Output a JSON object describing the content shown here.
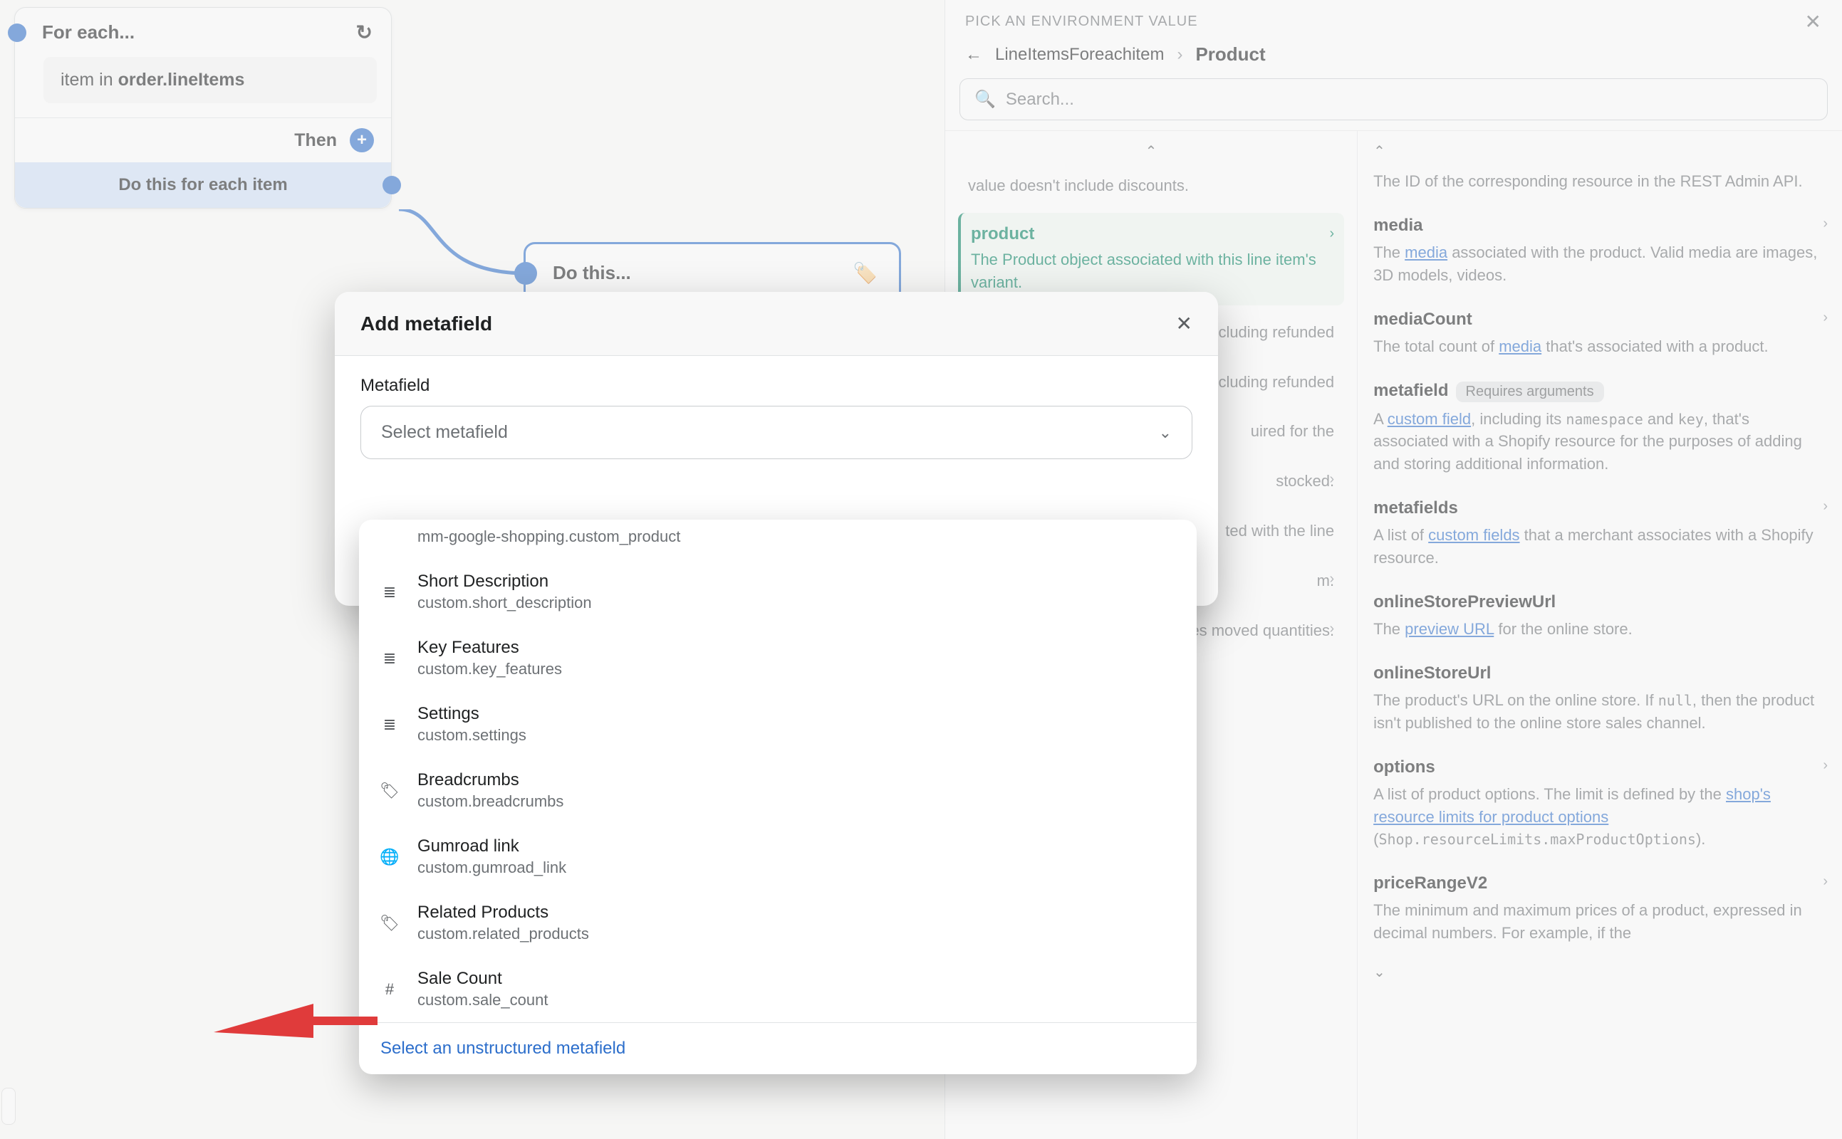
{
  "canvas": {
    "foreach_title": "For each...",
    "item_prefix": "item in ",
    "item_source": "order.lineItems",
    "then": "Then",
    "do_each": "Do this for each item",
    "do_this": "Do this..."
  },
  "panel": {
    "title": "PICK AN ENVIRONMENT VALUE",
    "back_label": "LineItemsForeachitem",
    "current": "Product",
    "search_placeholder": "Search..."
  },
  "left_fields": {
    "truncated_desc": "value doesn't include discounts.",
    "product_title": "product",
    "product_desc": "The Product object associated with this line item's variant.",
    "f1": "… including refunded",
    "f2": "excluding refunded",
    "f3": "uired for the",
    "f4": "stocked.",
    "f5": "ted with the line",
    "f6": "m.",
    "f7": "e item, including taxes moved quantities."
  },
  "props": {
    "p0_desc_prefix": "The ID of the corresponding resource in the REST Admin API.",
    "media_title": "media",
    "media_desc_a": "The ",
    "media_link": "media",
    "media_desc_b": " associated with the product. Valid media are images, 3D models, videos.",
    "mediaCount_title": "mediaCount",
    "mediaCount_a": "The total count of ",
    "mediaCount_link": "media",
    "mediaCount_b": " that's associated with a product.",
    "metafield_title": "metafield",
    "metafield_badge": "Requires arguments",
    "metafield_a": "A ",
    "metafield_link": "custom field",
    "metafield_b": ", including its ",
    "metafield_code1": "namespace",
    "metafield_c": " and ",
    "metafield_code2": "key",
    "metafield_d": ", that's associated with a Shopify resource for the purposes of adding and storing additional information.",
    "metafields_title": "metafields",
    "metafields_a": "A list of ",
    "metafields_link": "custom fields",
    "metafields_b": " that a merchant associates with a Shopify resource.",
    "preview_title": "onlineStorePreviewUrl",
    "preview_a": "The ",
    "preview_link": "preview URL",
    "preview_b": " for the online store.",
    "url_title": "onlineStoreUrl",
    "url_a": "The product's URL on the online store. If ",
    "url_code": "null",
    "url_b": ", then the product isn't published to the online store sales channel.",
    "options_title": "options",
    "options_a": "A list of product options. The limit is defined by the ",
    "options_link": "shop's resource limits for product options",
    "options_b": " (",
    "options_code": "Shop.resourceLimits.maxProductOptions",
    "options_c": ").",
    "price_title": "priceRangeV2",
    "price_desc": "The minimum and maximum prices of a product, expressed in decimal numbers. For example, if the"
  },
  "modal": {
    "title": "Add metafield",
    "label": "Metafield",
    "placeholder": "Select metafield",
    "footer_link": "Select an unstructured metafield"
  },
  "dropdown": {
    "top_key": "mm-google-shopping.custom_product",
    "items": [
      {
        "icon": "text",
        "title": "Short Description",
        "key": "custom.short_description"
      },
      {
        "icon": "text",
        "title": "Key Features",
        "key": "custom.key_features"
      },
      {
        "icon": "text",
        "title": "Settings",
        "key": "custom.settings"
      },
      {
        "icon": "tag",
        "title": "Breadcrumbs",
        "key": "custom.breadcrumbs"
      },
      {
        "icon": "globe",
        "title": "Gumroad link",
        "key": "custom.gumroad_link"
      },
      {
        "icon": "tag",
        "title": "Related Products",
        "key": "custom.related_products"
      },
      {
        "icon": "hash",
        "title": "Sale Count",
        "key": "custom.sale_count"
      }
    ]
  }
}
